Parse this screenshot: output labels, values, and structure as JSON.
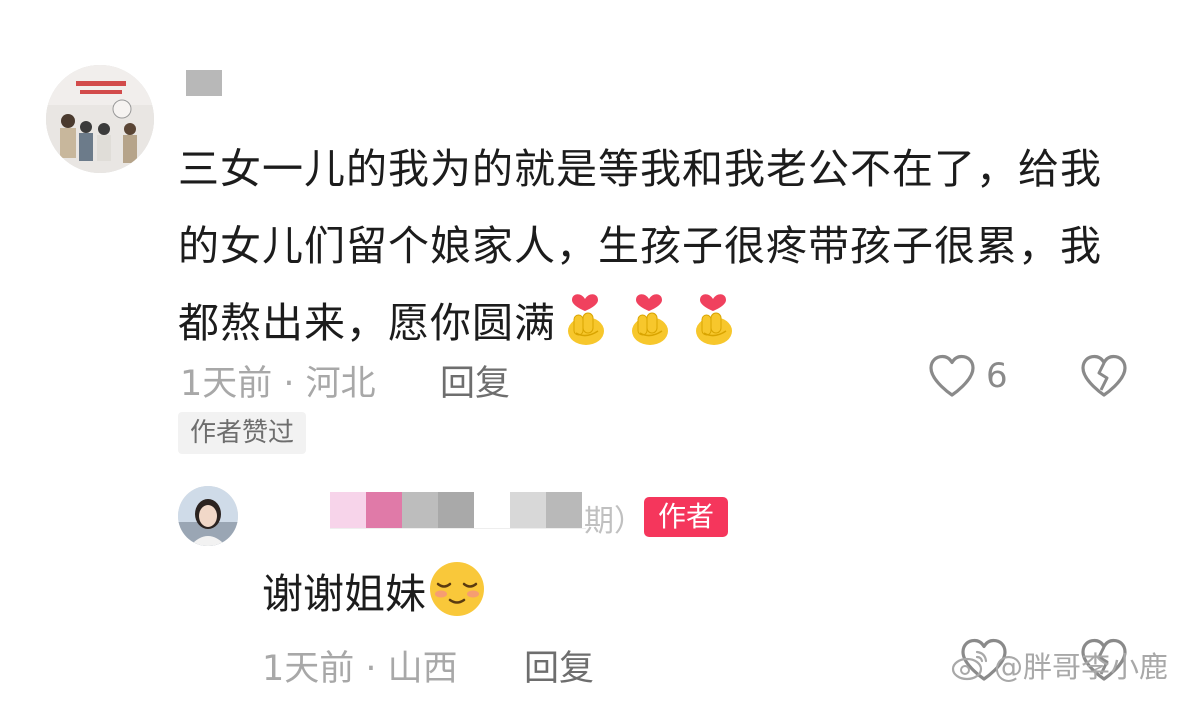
{
  "comment": {
    "text": "三女一儿的我为的就是等我和我老公不在了，给我的女儿们留个娘家人，生孩子很疼带孩子很累，我都熬出来，愿你圆满",
    "emoji": "heart-hand-emoji",
    "time_location": "1天前 · 河北",
    "reply_label": "回复",
    "like_count": "6",
    "author_liked_badge": "作者赞过"
  },
  "reply": {
    "name_suffix": "期）",
    "author_badge": "作者",
    "text": "谢谢姐妹",
    "emoji": "smiling-emoji",
    "time_location": "1天前 · 山西",
    "reply_label": "回复"
  },
  "watermark": {
    "text": "@胖哥李小鹿"
  },
  "colors": {
    "author_badge_bg": "#f5365c",
    "meta_text": "#a8a8a8",
    "badge_bg": "#f2f2f2"
  }
}
